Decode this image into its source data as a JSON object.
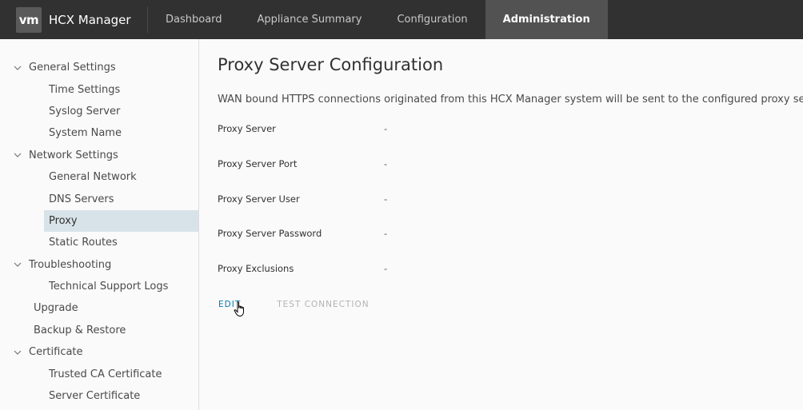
{
  "header": {
    "logo_text": "vm",
    "app_title": "HCX Manager",
    "tabs": [
      {
        "label": "Dashboard"
      },
      {
        "label": "Appliance Summary"
      },
      {
        "label": "Configuration"
      },
      {
        "label": "Administration"
      }
    ],
    "active_tab": "Administration"
  },
  "sidebar": {
    "items": [
      {
        "label": "General Settings"
      },
      {
        "label": "Time Settings"
      },
      {
        "label": "Syslog Server"
      },
      {
        "label": "System Name"
      },
      {
        "label": "Network Settings"
      },
      {
        "label": "General Network"
      },
      {
        "label": "DNS Servers"
      },
      {
        "label": "Proxy"
      },
      {
        "label": "Static Routes"
      },
      {
        "label": "Troubleshooting"
      },
      {
        "label": "Technical Support Logs"
      },
      {
        "label": "Upgrade"
      },
      {
        "label": "Backup & Restore"
      },
      {
        "label": "Certificate"
      },
      {
        "label": "Trusted CA Certificate"
      },
      {
        "label": "Server Certificate"
      }
    ]
  },
  "main": {
    "title": "Proxy Server Configuration",
    "description": "WAN bound HTTPS connections originated from this HCX Manager system will be sent to the configured proxy server.",
    "fields": [
      {
        "label": "Proxy Server",
        "value": "-"
      },
      {
        "label": "Proxy Server Port",
        "value": "-"
      },
      {
        "label": "Proxy Server User",
        "value": "-"
      },
      {
        "label": "Proxy Server Password",
        "value": "-"
      },
      {
        "label": "Proxy Exclusions",
        "value": "-"
      }
    ],
    "edit_label": "EDIT",
    "test_connection_label": "TEST CONNECTION"
  },
  "colors": {
    "header_bg": "#313131",
    "active_tab_bg": "#525252",
    "sidebar_active_bg": "#d8e3e9",
    "link_blue": "#0079b8",
    "disabled_gray": "#b3b3b3"
  }
}
